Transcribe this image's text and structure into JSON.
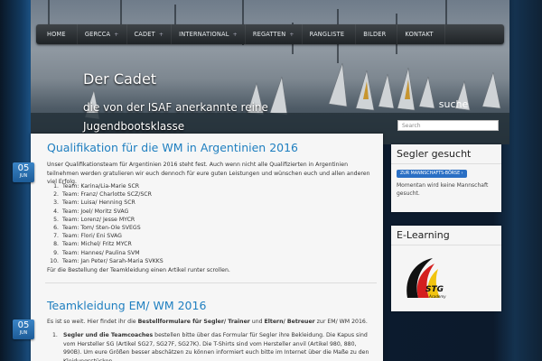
{
  "nav": [
    {
      "label": "HOME",
      "plus": ""
    },
    {
      "label": "GERCCA",
      "plus": "+"
    },
    {
      "label": "CADET",
      "plus": "+"
    },
    {
      "label": "INTERNATIONAL",
      "plus": "+"
    },
    {
      "label": "REGATTEN",
      "plus": "+"
    },
    {
      "label": "RANGLISTE",
      "plus": ""
    },
    {
      "label": "BILDER",
      "plus": ""
    },
    {
      "label": "KONTAKT",
      "plus": ""
    }
  ],
  "site": {
    "title": "Der Cadet",
    "description": "die von der ISAF anerkannte reine Jugendbootsklasse"
  },
  "sidebar": {
    "heading": "suche",
    "search_placeholder": "Search",
    "widget1": {
      "title": "Segler gesucht",
      "button": "ZUR MANNSCHAFTS-BÖRSE",
      "text": "Momentan wird keine Mannschaft gesucht."
    },
    "widget2": {
      "title": "E-Learning",
      "logo_text": "STG",
      "logo_sub": "Academy"
    }
  },
  "post1": {
    "title": "Qualifikation für die WM in Argentinien 2016",
    "day": "05",
    "month": "JUN",
    "intro": "Unser Qualifikationsteam für Argentinien 2016 steht fest. Auch wenn nicht alle Qualifizierten in Argentinien teilnehmen werden gratulieren wir euch dennoch für eure guten Leistungen und wünschen euch und allen anderen viel Erfolg.",
    "teams": [
      "Team: Karina/Lia-Marie SCR",
      "Team: Franz/ Charlotte SCZ/SCR",
      "Team: Luisa/ Henning SCR",
      "Team: Joel/ Moritz SVAG",
      "Team: Lorenz/ Jesse MYCR",
      "Team: Tom/ Sten-Ole SVEGS",
      "Team: Flori/ Eni SVAG",
      "Team: Michel/ Fritz MYCR",
      "Team: Hannes/ Paulina SVM",
      "Team: Jan Peter/ Sarah-Maria SVKKS"
    ],
    "outro": "Für die Bestellung der Teamkleidung einen Artikel runter scrollen."
  },
  "post2": {
    "title": "Teamkleidung EM/ WM 2016",
    "day": "05",
    "month": "JUN",
    "intro_a": "Es ist so weit. Hier findet ihr die ",
    "intro_b1": "Bestellformulare für Segler/ Trainer",
    "intro_c": " und ",
    "intro_b2": "Eltern/ Betreuer",
    "intro_d": " zur EM/ WM 2016.",
    "item1_num": "1.",
    "item1_bold": "Segler und die Teamcoaches",
    "item1_text": " bestellen bitte über das Formular für Segler ihre Bekleidung. Die Kapus sind vom Hersteller SG (Artikel SG27, SG27F, SG27K). Die T-Shirts sind vom Hersteller anvil (Artikel 980, 880, 990B). Um eure Größen besser abschätzen zu können informiert euch bitte im Internet über die Maße zu den Kleidungsstücken."
  },
  "colors": {
    "accent": "#1f7fc0",
    "button": "#2a6fc4",
    "date_badge": "#2a70b0"
  }
}
